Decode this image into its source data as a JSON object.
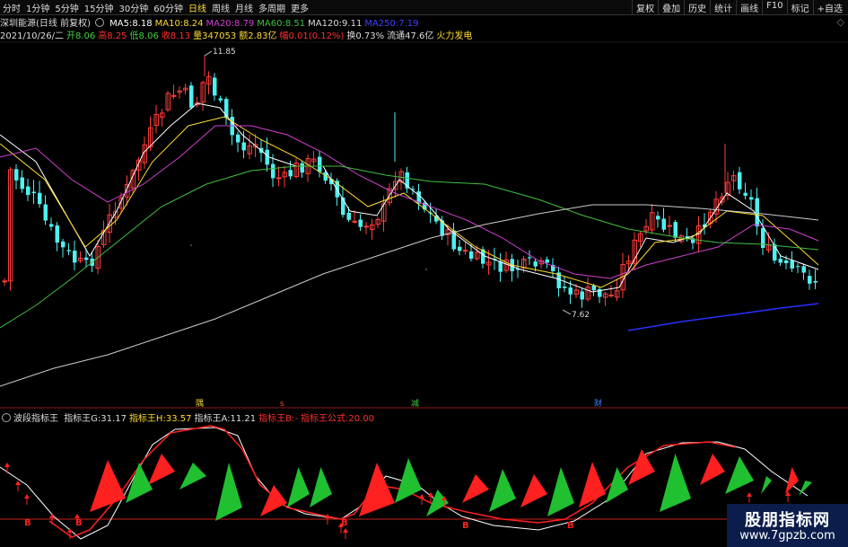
{
  "toolbar": {
    "periods": [
      "分时",
      "1分钟",
      "5分钟",
      "15分钟",
      "30分钟",
      "60分钟",
      "日线",
      "周线",
      "月线",
      "多周期",
      "更多"
    ],
    "active_period": "日线",
    "tools": [
      "复权",
      "叠加",
      "历史",
      "统计",
      "画线",
      "F10",
      "标记",
      "+自选"
    ]
  },
  "header": {
    "stock": "深圳能源(日线 前复权)",
    "ma": [
      {
        "label": "MA5:",
        "value": "8.18",
        "color": "#ffffff"
      },
      {
        "label": "MA10:",
        "value": "8.24",
        "color": "#ffdc32"
      },
      {
        "label": "MA20:",
        "value": "8.79",
        "color": "#d040d0"
      },
      {
        "label": "MA60:",
        "value": "8.51",
        "color": "#40c040"
      },
      {
        "label": "MA120:",
        "value": "9.11",
        "color": "#dddddd"
      },
      {
        "label": "MA250:",
        "value": "7.19",
        "color": "#4040ff"
      }
    ],
    "quote": [
      {
        "label": "2021/10/26/二",
        "value": "",
        "color": "#dddddd"
      },
      {
        "label": "开",
        "value": "8.06",
        "color": "#40d040"
      },
      {
        "label": "高",
        "value": "8.25",
        "color": "#ff3030"
      },
      {
        "label": "低",
        "value": "8.06",
        "color": "#40d040"
      },
      {
        "label": "收",
        "value": "8.13",
        "color": "#ff3030"
      },
      {
        "label": "量",
        "value": "347053",
        "color": "#ffdc32"
      },
      {
        "label": "额",
        "value": "2.83亿",
        "color": "#ffdc32"
      },
      {
        "label": "幅",
        "value": "0.01(0.12%)",
        "color": "#ff3030"
      },
      {
        "label": "换",
        "value": "0.73%",
        "color": "#dddddd"
      },
      {
        "label": "流通",
        "value": "47.6亿",
        "color": "#dddddd"
      },
      {
        "label": "",
        "value": "火力发电",
        "color": "#ffdc32"
      }
    ]
  },
  "price_chart": {
    "high_label": "11.85",
    "low_label": "7.62",
    "markers": [
      {
        "text": "隅",
        "color": "#ffdc32"
      },
      {
        "text": "s",
        "color": "#ff4040"
      },
      {
        "text": "减",
        "color": "#40d040"
      },
      {
        "text": "财",
        "color": "#4080ff"
      }
    ]
  },
  "indicator": {
    "name": "波段指标王",
    "items": [
      {
        "label": "指标王G:",
        "value": "31.17",
        "color": "#dddddd"
      },
      {
        "label": "指标王H:",
        "value": "33.57",
        "color": "#ffdc32"
      },
      {
        "label": "指标王A:",
        "value": "11.21",
        "color": "#dddddd"
      },
      {
        "label": "指标王B:",
        "value": "-",
        "color": "#ff3030"
      },
      {
        "label": "指标王公式:",
        "value": "20.00",
        "color": "#ff3030"
      }
    ],
    "buy_label": "B"
  },
  "watermark": {
    "title": "股朋指标网",
    "url": "www.7gpzb.com"
  }
}
